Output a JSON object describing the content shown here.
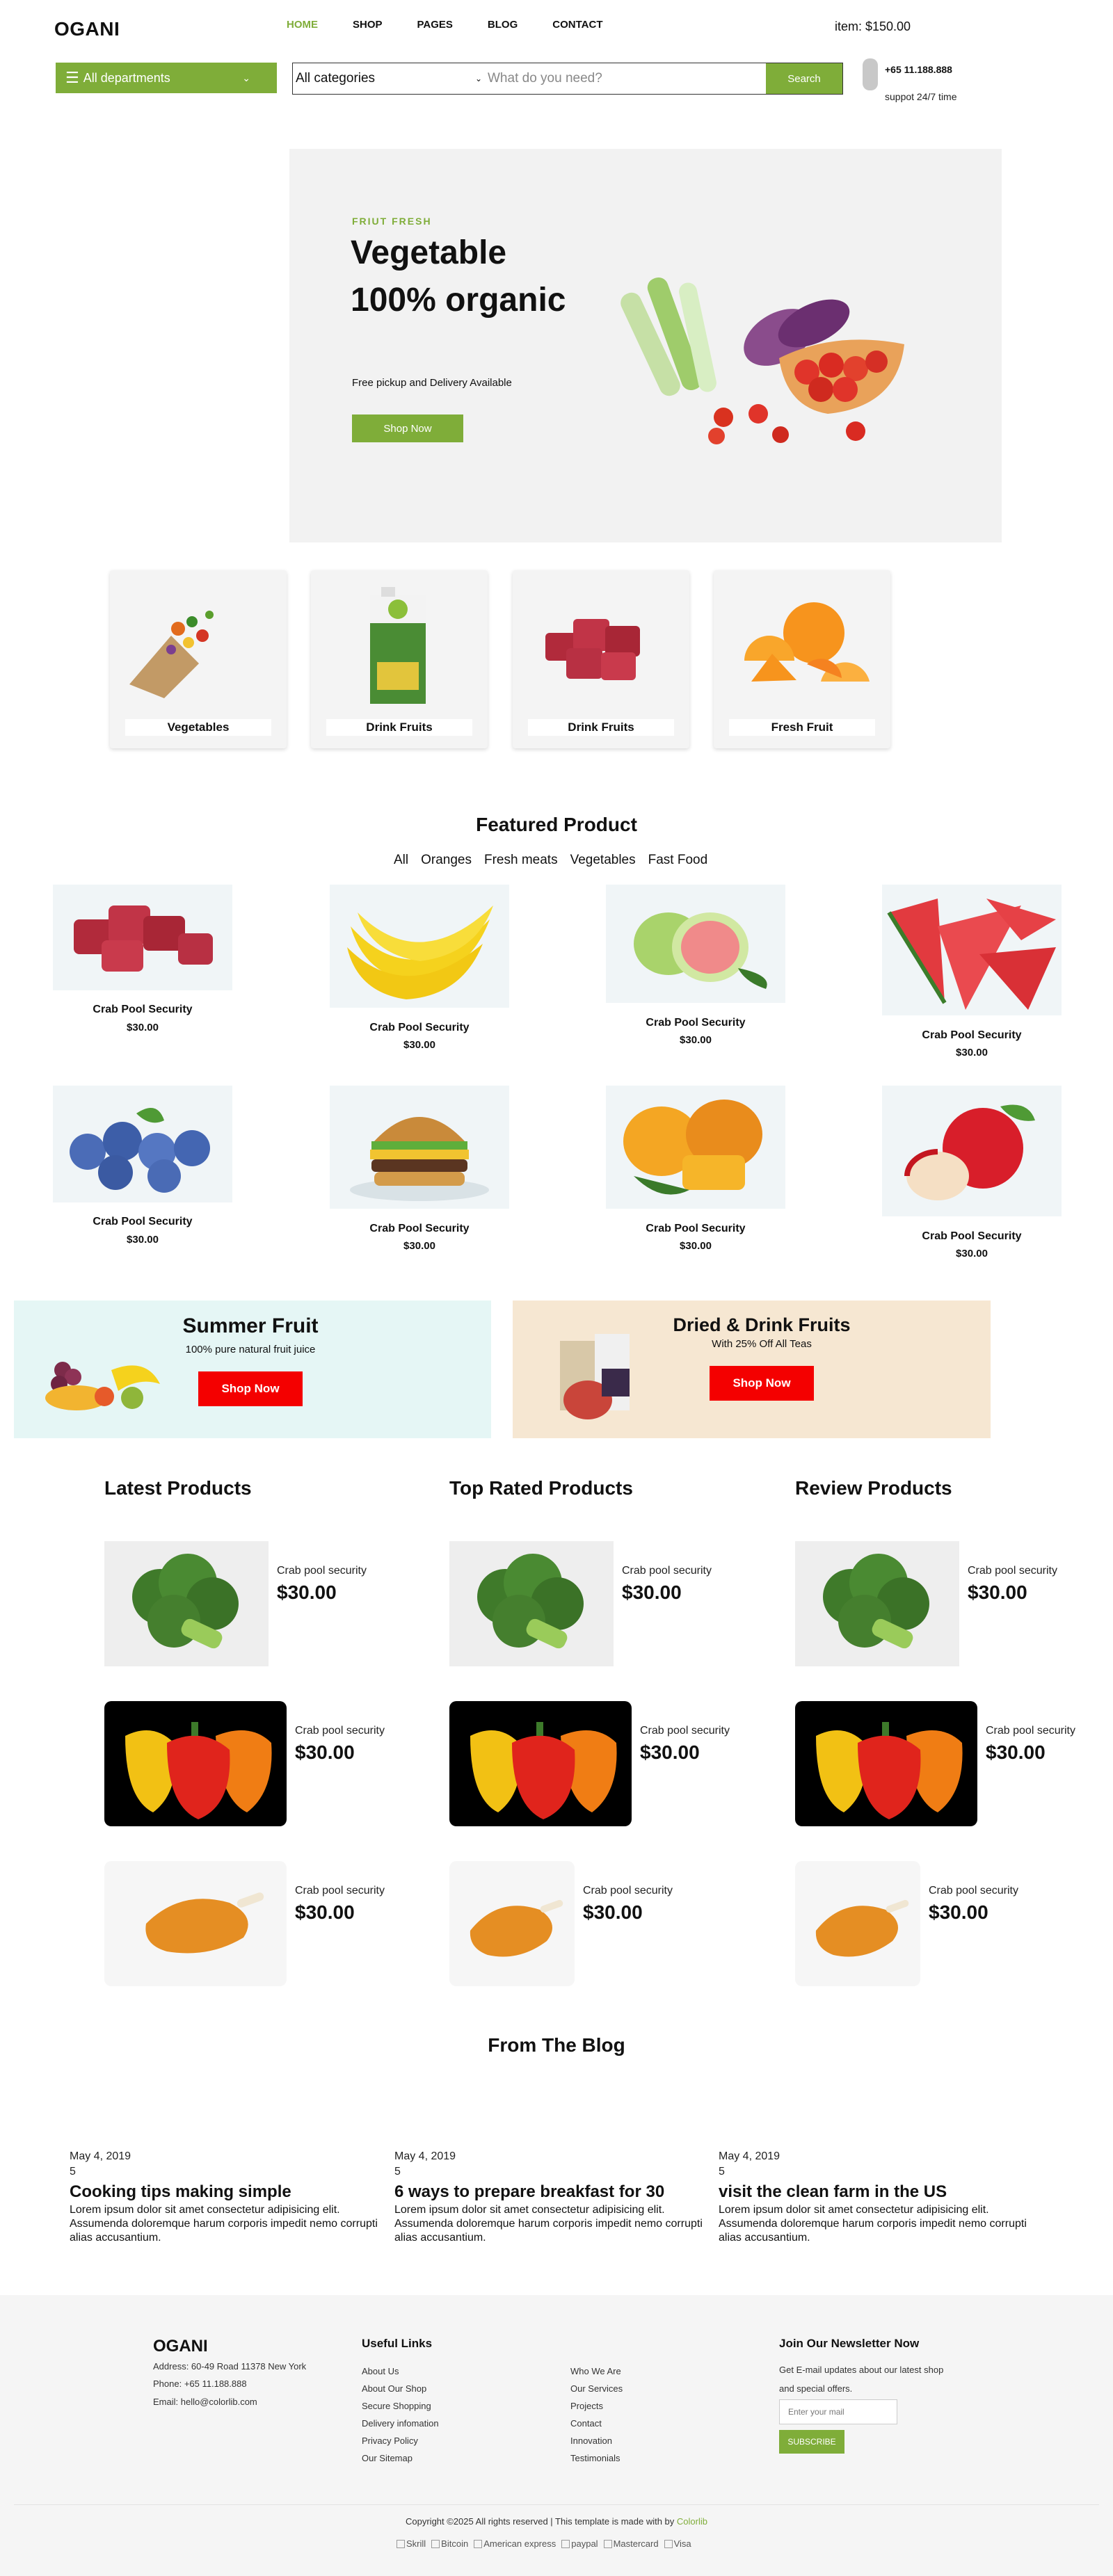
{
  "header": {
    "logo": "OGANI",
    "nav": [
      "HOME",
      "SHOP",
      "PAGES",
      "BLOG",
      "CONTACT"
    ],
    "cart": "item: $150.00",
    "departments": "All departments",
    "category_select": "All categories",
    "search_placeholder": "What do you need?",
    "search_button": "Search",
    "phone": "+65 11.188.888",
    "support": "suppot 24/7 time"
  },
  "hero": {
    "tag": "FRIUT FRESH",
    "title": "Vegetable 100% organic",
    "subtitle": "Free pickup and Delivery Available",
    "button": "Shop Now"
  },
  "categories": [
    "Vegetables",
    "Drink Fruits",
    "Drink Fruits",
    "Fresh Fruit"
  ],
  "featured": {
    "title": "Featured Product",
    "filters": [
      "All",
      "Oranges",
      "Fresh meats",
      "Vegetables",
      "Fast Food"
    ],
    "products": [
      {
        "name": "Crab Pool Security",
        "price": "$30.00",
        "image": "meat"
      },
      {
        "name": "Crab Pool Security",
        "price": "$30.00",
        "image": "banana"
      },
      {
        "name": "Crab Pool Security",
        "price": "$30.00",
        "image": "guava"
      },
      {
        "name": "Crab Pool Security",
        "price": "$30.00",
        "image": "watermelon"
      },
      {
        "name": "Crab Pool Security",
        "price": "$30.00",
        "image": "blueberry"
      },
      {
        "name": "Crab Pool Security",
        "price": "$30.00",
        "image": "burger"
      },
      {
        "name": "Crab Pool Security",
        "price": "$30.00",
        "image": "mango"
      },
      {
        "name": "Crab Pool Security",
        "price": "$30.00",
        "image": "apple"
      }
    ]
  },
  "banners": [
    {
      "title": "Summer Fruit",
      "subtitle": "100% pure natural fruit juice",
      "button": "Shop Now",
      "bg": "#e5f6f5"
    },
    {
      "title": "Dried & Drink Fruits",
      "subtitle": "With 25% Off All Teas",
      "button": "Shop Now",
      "bg": "#f6e7d2"
    }
  ],
  "product_lists": [
    {
      "title": "Latest Products",
      "items": [
        {
          "name": "Crab pool security",
          "price": "$30.00",
          "image": "broccoli"
        },
        {
          "name": "Crab pool security",
          "price": "$30.00",
          "image": "peppers"
        },
        {
          "name": "Crab pool security",
          "price": "$30.00",
          "image": "chicken"
        }
      ]
    },
    {
      "title": "Top Rated Products",
      "items": [
        {
          "name": "Crab pool security",
          "price": "$30.00",
          "image": "broccoli"
        },
        {
          "name": "Crab pool security",
          "price": "$30.00",
          "image": "peppers"
        },
        {
          "name": "Crab pool security",
          "price": "$30.00",
          "image": "chicken"
        }
      ]
    },
    {
      "title": "Review Products",
      "items": [
        {
          "name": "Crab pool security",
          "price": "$30.00",
          "image": "broccoli"
        },
        {
          "name": "Crab pool security",
          "price": "$30.00",
          "image": "peppers"
        },
        {
          "name": "Crab pool security",
          "price": "$30.00",
          "image": "chicken"
        }
      ]
    }
  ],
  "blog": {
    "title": "From The Blog",
    "posts": [
      {
        "date": "May 4, 2019",
        "comments": "5",
        "title": "Cooking tips making simple",
        "text": "Lorem ipsum dolor sit amet consectetur adipisicing elit. Assumenda doloremque harum corporis impedit nemo corrupti alias accusantium."
      },
      {
        "date": "May 4, 2019",
        "comments": "5",
        "title": "6 ways to prepare breakfast for 30",
        "text": "Lorem ipsum dolor sit amet consectetur adipisicing elit. Assumenda doloremque harum corporis impedit nemo corrupti alias accusantium."
      },
      {
        "date": "May 4, 2019",
        "comments": "5",
        "title": "visit the clean farm in the US",
        "text": "Lorem ipsum dolor sit amet consectetur adipisicing elit. Assumenda doloremque harum corporis impedit nemo corrupti alias accusantium."
      }
    ]
  },
  "footer": {
    "logo": "OGANI",
    "address": "Address: 60-49 Road 11378 New York",
    "phone": "Phone: +65 11.188.888",
    "email": "Email: hello@colorlib.com",
    "useful_links_title": "Useful Links",
    "links_col1": [
      "About Us",
      "About Our Shop",
      "Secure Shopping",
      "Delivery infomation",
      "Privacy Policy",
      "Our Sitemap"
    ],
    "links_col2": [
      "Who We Are",
      "Our Services",
      "Projects",
      "Contact",
      "Innovation",
      "Testimonials"
    ],
    "newsletter_title": "Join Our Newsletter Now",
    "newsletter_text_1": "Get E-mail updates about our latest shop",
    "newsletter_text_2": "and special offers.",
    "newsletter_placeholder": "Enter your mail",
    "newsletter_button": "SUBSCRIBE",
    "copyright": "Copyright ©2025 All rights reserved | This template is made with by",
    "copyright_brand": "Colorlib",
    "payments": [
      "Skrill",
      "Bitcoin",
      "American express",
      "paypal",
      "Mastercard",
      "Visa"
    ]
  },
  "colors": {
    "accent": "#7fad39",
    "sale_button": "#f40000",
    "hero_bg": "#f2f2f2",
    "footer_bg": "#f5f5f5"
  }
}
